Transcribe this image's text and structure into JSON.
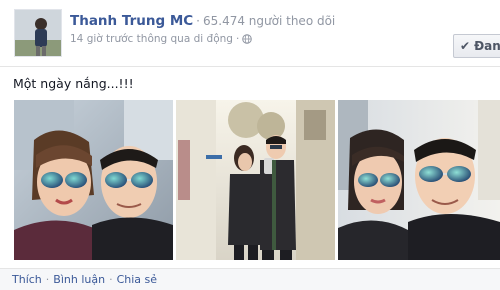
{
  "post": {
    "page_name": "Thanh Trung MC",
    "followers": "65.474 người theo dõi",
    "time": "14 giờ trước thông qua di động",
    "follow_button": "Đang",
    "text": "Một ngày nắng...!!!"
  },
  "icons": {
    "privacy": "globe-icon",
    "follow_state": "check-icon"
  },
  "photos": [
    {
      "name": "selfie-photo-1"
    },
    {
      "name": "mirror-photo-2"
    },
    {
      "name": "selfie-photo-3"
    }
  ],
  "actions": {
    "like": "Thích",
    "comment": "Bình luận",
    "share": "Chia sẻ"
  },
  "colors": {
    "link": "#3b5998",
    "meta": "#9197a3",
    "action_bar": "#f6f7f9"
  }
}
